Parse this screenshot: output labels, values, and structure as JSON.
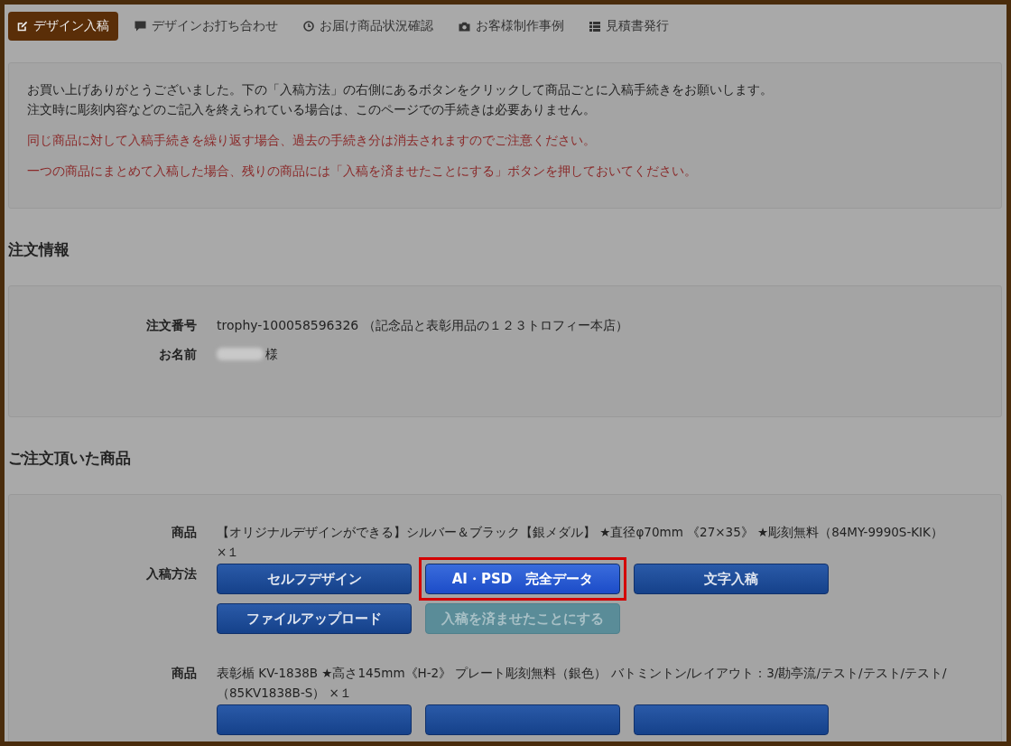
{
  "nav_tabs": [
    {
      "label": "デザイン入稿",
      "selected": true
    },
    {
      "label": "デザインお打ち合わせ",
      "selected": false
    },
    {
      "label": "お届け商品状況確認",
      "selected": false
    },
    {
      "label": "お客様制作事例",
      "selected": false
    },
    {
      "label": "見積書発行",
      "selected": false
    }
  ],
  "notice": [
    {
      "text": "お買い上げありがとうございました。下の「入稿方法」の右側にあるボタンをクリックして商品ごとに入稿手続きをお願いします。",
      "kind": "info"
    },
    {
      "text": "注文時に彫刻内容などのご記入を終えられている場合は、このページでの手続きは必要ありません。",
      "kind": "info"
    },
    {
      "text": "同じ商品に対して入稿手続きを繰り返す場合、過去の手続き分は消去されますのでご注意ください。",
      "kind": "warning"
    },
    {
      "text": "一つの商品にまとめて入稿した場合、残りの商品には「入稿を済ませたことにする」ボタンを押しておいてください。",
      "kind": "warning"
    }
  ],
  "order_info": {
    "heading": "注文情報",
    "rows": [
      {
        "label": "注文番号",
        "value": "trophy-100058596326 （記念品と表彰用品の１２３トロフィー本店）",
        "blurred": false
      },
      {
        "label": "お名前",
        "value": "様",
        "blurred": true
      }
    ]
  },
  "products": {
    "heading": "ご注文頂いた商品",
    "items": [
      {
        "label": "商品",
        "name": "【オリジナルデザインができる】シルバー＆ブラック【銀メダル】 ★直径φ70mm 《27×35》 ★彫刻無料（84MY-9990S-KIK） ×１",
        "method_label": "入稿方法",
        "methods": [
          {
            "label": "セルフデザイン",
            "highlighted": false,
            "disabled": false
          },
          {
            "label": "AI・PSD　完全データ",
            "highlighted": true,
            "disabled": false
          },
          {
            "label": "文字入稿",
            "highlighted": false,
            "disabled": false
          },
          {
            "label": "ファイルアップロード",
            "highlighted": false,
            "disabled": false
          },
          {
            "label": "入稿を済ませたことにする",
            "highlighted": false,
            "disabled": true
          }
        ]
      },
      {
        "label": "商品",
        "name": "表彰楯 KV-1838B ★高さ145mm《H-2》 プレート彫刻無料（銀色） バトミントン/レイアウト：3/勘亭流/テスト/テスト/テスト/（85KV1838B-S） ×１",
        "methods": [
          {
            "highlighted": false,
            "disabled": false
          },
          {
            "highlighted": false,
            "disabled": false
          },
          {
            "highlighted": false,
            "disabled": false
          }
        ]
      }
    ]
  }
}
